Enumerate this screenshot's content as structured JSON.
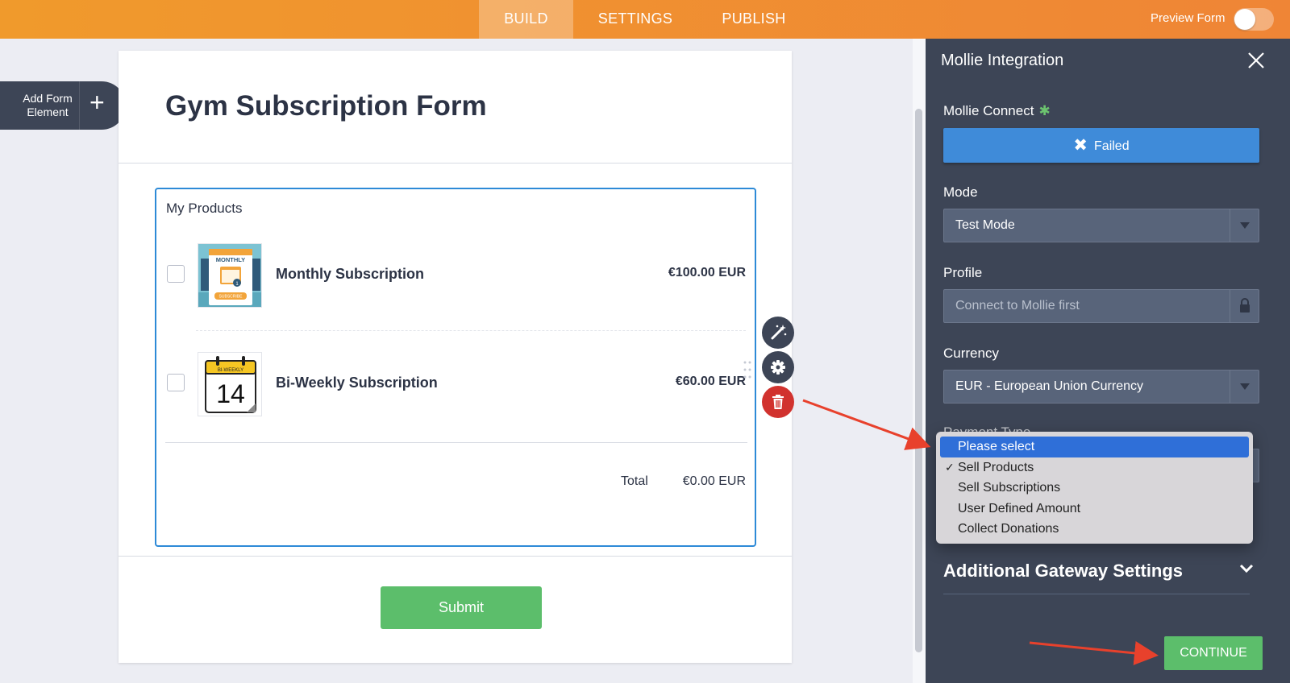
{
  "topbar": {
    "tabs": [
      "BUILD",
      "SETTINGS",
      "PUBLISH"
    ],
    "active_tab": "BUILD",
    "preview_label": "Preview Form",
    "preview_on": false,
    "accent": "#EF8B33"
  },
  "sidebar": {
    "add_element_label": "Add Form Element"
  },
  "form": {
    "title": "Gym Subscription Form",
    "products_heading": "My Products",
    "products": [
      {
        "name": "Monthly Subscription",
        "price": "€100.00",
        "currency": "EUR",
        "image": "monthly-calendar-image",
        "checked": false
      },
      {
        "name": "Bi-Weekly Subscription",
        "price": "€60.00",
        "currency": "EUR",
        "image": "biweekly-calendar-image",
        "checked": false
      }
    ],
    "total_label": "Total",
    "total_value": "€0.00",
    "total_currency": "EUR",
    "submit_label": "Submit",
    "tools": [
      "wand-icon",
      "gear-icon",
      "trash-icon"
    ]
  },
  "panel": {
    "title": "Mollie Integration",
    "connect_label": "Mollie Connect",
    "connect_status": "Failed",
    "mode_label": "Mode",
    "mode_value": "Test Mode",
    "profile_label": "Profile",
    "profile_placeholder": "Connect to Mollie first",
    "currency_label": "Currency",
    "currency_value": "EUR - European Union Currency",
    "payment_type_label": "Payment Type",
    "payment_options": [
      "Please select",
      "Sell Products",
      "Sell Subscriptions",
      "User Defined Amount",
      "Collect Donations"
    ],
    "payment_highlighted": "Please select",
    "payment_checked": "Sell Products",
    "gateway_label": "Additional Gateway Settings",
    "continue_label": "CONTINUE"
  },
  "colors": {
    "panel_bg": "#3D4556",
    "failed_blue": "#3F8BD9",
    "green": "#5CBE6B",
    "delete_red": "#D1322E",
    "arrow_red": "#E8412C"
  }
}
